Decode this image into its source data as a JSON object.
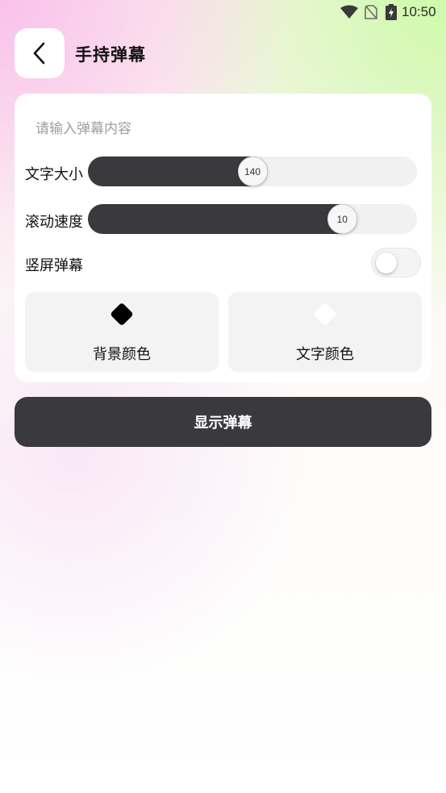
{
  "status_bar": {
    "time": "10:50",
    "icons": [
      "wifi-icon",
      "no-sim-icon",
      "battery-charging-icon"
    ]
  },
  "header": {
    "back_icon": "chevron-left-icon",
    "title": "手持弹幕"
  },
  "form": {
    "input": {
      "placeholder": "请输入弹幕内容",
      "value": ""
    },
    "font_size": {
      "label": "文字大小",
      "value": "140",
      "fraction": 0.5
    },
    "scroll_speed": {
      "label": "滚动速度",
      "value": "10",
      "fraction": 0.8
    },
    "vertical": {
      "label": "竖屏弹幕",
      "on": false
    },
    "background_color": {
      "label": "背景颜色",
      "color": "#000000"
    },
    "text_color": {
      "label": "文字颜色",
      "color": "#ffffff"
    }
  },
  "show_button": {
    "label": "显示弹幕"
  },
  "colors": {
    "accent_dark": "#3a393d",
    "track": "#f1f1f2",
    "tile": "#f3f3f4"
  }
}
